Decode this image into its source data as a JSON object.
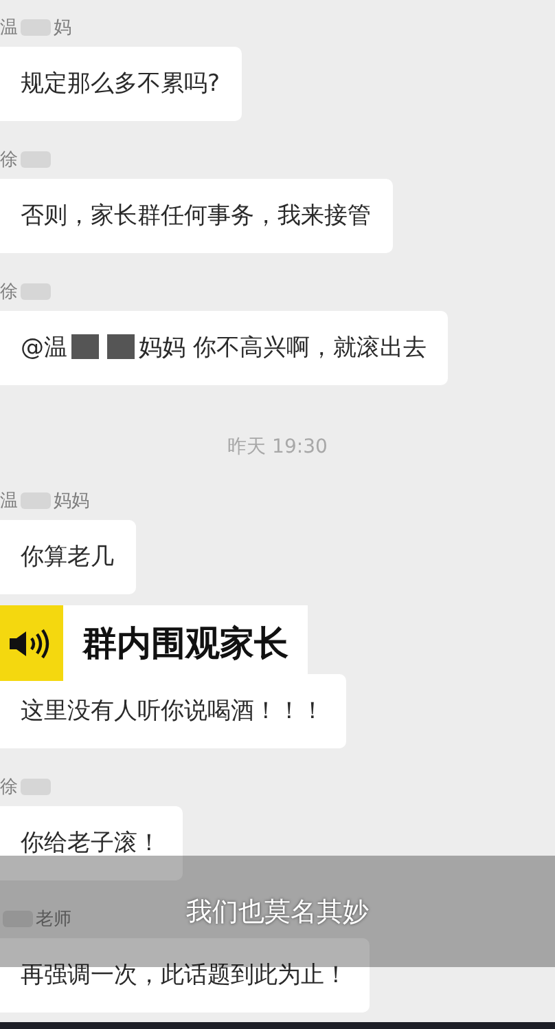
{
  "chat": [
    {
      "kind": "message",
      "sender": [
        {
          "kind": "text",
          "text": "温"
        },
        {
          "kind": "redaction"
        },
        {
          "kind": "text",
          "text": "妈"
        }
      ],
      "body": [
        {
          "kind": "text",
          "text": "规定那么多不累吗?"
        }
      ]
    },
    {
      "kind": "message",
      "sender": [
        {
          "kind": "text",
          "text": "徐"
        },
        {
          "kind": "redaction"
        }
      ],
      "body": [
        {
          "kind": "text",
          "text": "否则，家长群任何事务，我来接管"
        }
      ]
    },
    {
      "kind": "message",
      "sender": [
        {
          "kind": "text",
          "text": "徐"
        },
        {
          "kind": "redaction"
        }
      ],
      "body": [
        {
          "kind": "text",
          "text": "@温"
        },
        {
          "kind": "redaction"
        },
        {
          "kind": "redaction"
        },
        {
          "kind": "text",
          "text": "妈妈 你不高兴啊，就滚出去"
        }
      ]
    },
    {
      "kind": "time",
      "text": "昨天 19:30"
    },
    {
      "kind": "message",
      "sender": [
        {
          "kind": "text",
          "text": "温"
        },
        {
          "kind": "redaction"
        },
        {
          "kind": "text",
          "text": "妈妈"
        }
      ],
      "body": [
        {
          "kind": "text",
          "text": "你算老几"
        }
      ]
    },
    {
      "kind": "message",
      "body": [
        {
          "kind": "text",
          "text": "这里没有人听你说喝酒！！！"
        }
      ]
    },
    {
      "kind": "message",
      "sender": [
        {
          "kind": "text",
          "text": "徐"
        },
        {
          "kind": "redaction"
        }
      ],
      "body": [
        {
          "kind": "text",
          "text": "你给老子滚！"
        }
      ]
    },
    {
      "kind": "message",
      "sender": [
        {
          "kind": "redaction"
        },
        {
          "kind": "text",
          "text": "老师"
        }
      ],
      "body": [
        {
          "kind": "text",
          "text": "再强调一次，此话题到此为止！"
        }
      ]
    }
  ],
  "caption": {
    "text": "群内围观家长"
  },
  "subtitle": {
    "text": "我们也莫名其妙"
  }
}
